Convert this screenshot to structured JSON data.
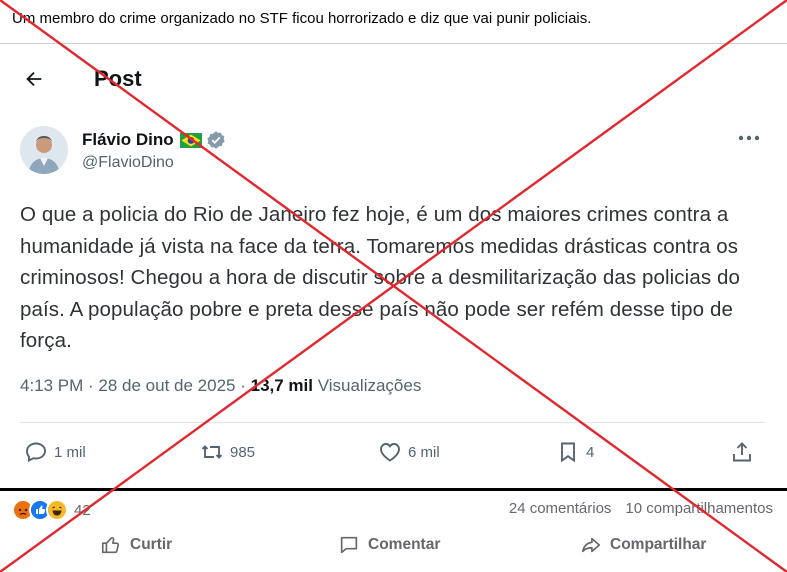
{
  "caption": "Um membro do crime organizado no STF ficou horrorizado e diz que vai punir policiais.",
  "tweet": {
    "header_title": "Post",
    "author_name": "Flávio Dino",
    "author_handle": "@FlavioDino",
    "body": "O que a policia do Rio de Janeiro fez hoje, é um dos maiores crimes contra a humanidade já vista na face da terra. Tomaremos medidas drásticas contra os criminosos! Chegou a hora de discutir sobre a desmilitarização das policias do país. A população pobre e preta desse país não pode ser refém desse tipo de força.",
    "timestamp": "4:13 PM · 28 de out de 2025 · ",
    "views_count": "13,7 mil",
    "views_label": " Visualizações",
    "replies": "1 mil",
    "reposts": "985",
    "likes": "6 mil",
    "bookmarks": "4"
  },
  "facebook": {
    "reaction_count": "42",
    "comments": "24 comentários",
    "shares": "10 compartilhamentos",
    "like_label": "Curtir",
    "comment_label": "Comentar",
    "share_label": "Compartilhar"
  },
  "colors": {
    "x_mark": "#e0282e",
    "verified": "#829aab",
    "secondary_text": "#536471"
  },
  "icons": [
    "back-arrow-icon",
    "brazil-flag-icon",
    "verified-badge-icon",
    "more-options-icon",
    "reply-icon",
    "repost-icon",
    "like-icon",
    "bookmark-icon",
    "share-icon",
    "angry-reaction-icon",
    "like-reaction-icon",
    "haha-reaction-icon",
    "thumbs-up-icon",
    "comment-icon",
    "share-arrow-icon"
  ]
}
